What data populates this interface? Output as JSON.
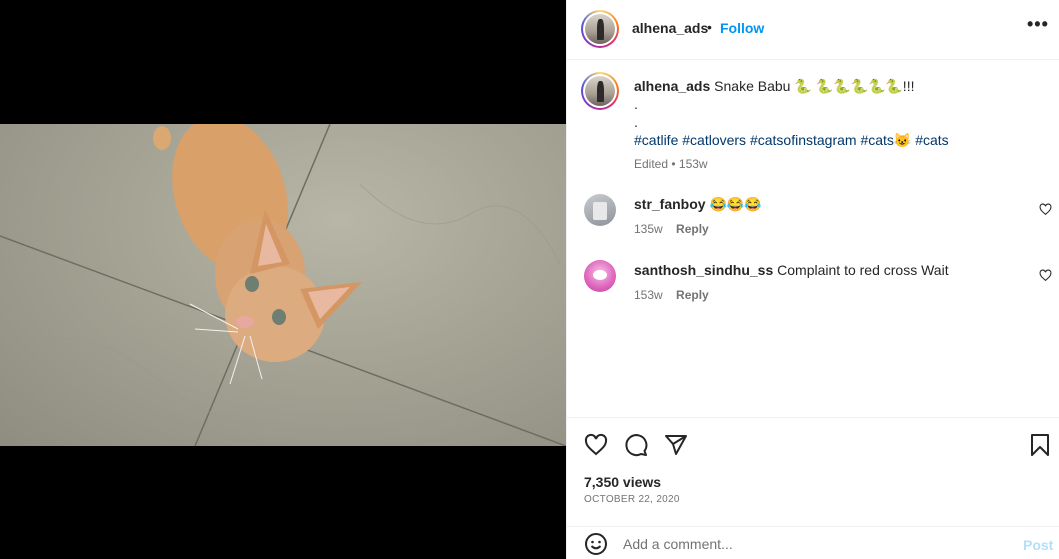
{
  "post": {
    "author": "alhena_ads",
    "follow_label": "Follow",
    "dot": "•",
    "more_icon": "more-horizontal-icon",
    "caption_text": "Snake Babu 🐍 🐍🐍🐍🐍🐍!!!",
    "caption_dots": [
      ".",
      "."
    ],
    "hashtags": "#catlife #catlovers #catsofinstagram #cats😺 #cats",
    "caption_meta": "Edited • 153w"
  },
  "comments": [
    {
      "user": "str_fanboy",
      "text": "😂😂😂",
      "age": "135w",
      "reply_label": "Reply"
    },
    {
      "user": "santhosh_sindhu_ss",
      "text": "Complaint to red cross Wait",
      "age": "153w",
      "reply_label": "Reply"
    }
  ],
  "stats": {
    "views": "7,350 views",
    "date": "OCTOBER 22, 2020"
  },
  "composer": {
    "placeholder": "Add a comment...",
    "post_label": "Post"
  },
  "colors": {
    "accent": "#0095f6",
    "hashtag": "#00376b",
    "muted": "#737373"
  }
}
